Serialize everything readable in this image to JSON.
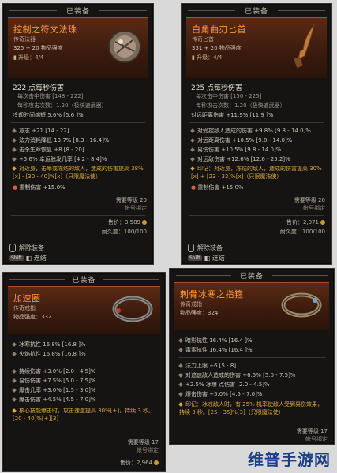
{
  "cards": [
    {
      "equipped": "已装备",
      "name": "控制之符文法珠",
      "type": "传奇法器",
      "power": "325 + 20 物品强度",
      "upgrade": "升级：4/4",
      "main_stat": "222 点每秒伤害",
      "sub_stats": [
        "每次击中伤害 [148 - 222]",
        "每秒攻击次数：1.20（极快速武器）"
      ],
      "implicit": "冷却时间缩短 5.6% [5.6 ]%",
      "affixes": [
        "意志 +21 [14 - 22]",
        "法力消耗降低 13.7% [8.3 - 16.4]%",
        "击杀生命恢复 +8 [8 - 20]",
        "+5.6% 幸运触发几率 [4.2 - 8.4]%"
      ],
      "legendary": "对近身，击晕或冻结的敌人，造成的伤害提高 38%[x] - [30 - 40]%[x]（只限魔法使）",
      "socket": "重制伤害 +15.0%",
      "req_level": "需要等级 20",
      "bound": "帐号绑定",
      "sell": "售价：3,589",
      "durability": "耐久度：100/100",
      "actions": [
        "解除装备",
        "连结"
      ]
    },
    {
      "equipped": "已装备",
      "name": "白角曲刃匕首",
      "type": "传奇匕首",
      "power": "331 + 20 物品强度",
      "upgrade": "升级：4/4",
      "main_stat": "225 点每秒伤害",
      "sub_stats": [
        "每次击中伤害 [150 - 225]",
        "每秒攻击次数：1.20（极快速武器）"
      ],
      "implicit": "对远距离伤害 +11.9% [11.9 ]%",
      "affixes": [
        "对受控敌人造成的伤害 +9.8% [9.8 - 14.0]%",
        "对远距离伤害 +10.5% [9.8 - 14.0]%",
        "易伤伤害 +10.5% [9.8 - 14.0]%",
        "对远敌伤害 +12.6% [12.6 - 25.2]%"
      ],
      "legendary": "印记：对近身，冻结的敌人，造成的伤害提高 30%[x] + [23 - 33]%[x]（只限魔法使）",
      "socket": "重制伤害 +15.0%",
      "req_level": "需要等级 20",
      "bound": "帐号绑定",
      "sell": "售价：2,071",
      "durability": "耐久度：100/100",
      "actions": [
        "解除装备",
        "连结"
      ]
    },
    {
      "equipped": "已装备",
      "name": "加速圈",
      "type": "传奇戒指",
      "power": "物品强度：332",
      "resists": [
        "冰寒抗性 16.8% [16.8 ]%",
        "火焰抗性 16.8% [16.8 ]%"
      ],
      "affixes": [
        "持续伤害 +3.0% [2.0 - 4.5]%",
        "易伤伤害 +7.5% [5.0 - 7.5]%",
        "爆击几率 +3.0% [1.5 - 3.0]%",
        "爆击伤害 +4.5% [4.5 - 7.0]%"
      ],
      "legendary": "核心技能爆击时，攻击速度提高 30%[+]，持续 3 秒。[20 - 40]%[+][3]",
      "req_level": "需要等级 17",
      "bound": "帐号绑定",
      "sell": "售价：2,964"
    },
    {
      "equipped": "已装备",
      "name": "刺骨冰寒之指箍",
      "type": "传奇戒指",
      "power": "物品强度：324",
      "resists": [
        "暗影抗性 16.4% [16.4 ]%",
        "毒素抗性 16.4% [16.4 ]%"
      ],
      "affixes": [
        "法力上限 +6 [5 - 8]",
        "对遮速敌人造成的伤害 +6.5% [5.0 - 7.5]%",
        "+2.5% 冰爆 点伤害 [2.0 - 4.5]%",
        "爆击伤害 +5.0% [4.5 - 7.0]%"
      ],
      "legendary": "印记：冰凉敌人时，有 25% 机率使敌人受到易伤效果，持续 3 秒。[25 - 35]%[3]（只限魔法使）",
      "req_level": "需要等级 17",
      "bound": "帐号绑定"
    }
  ],
  "watermark": "维普手游网"
}
